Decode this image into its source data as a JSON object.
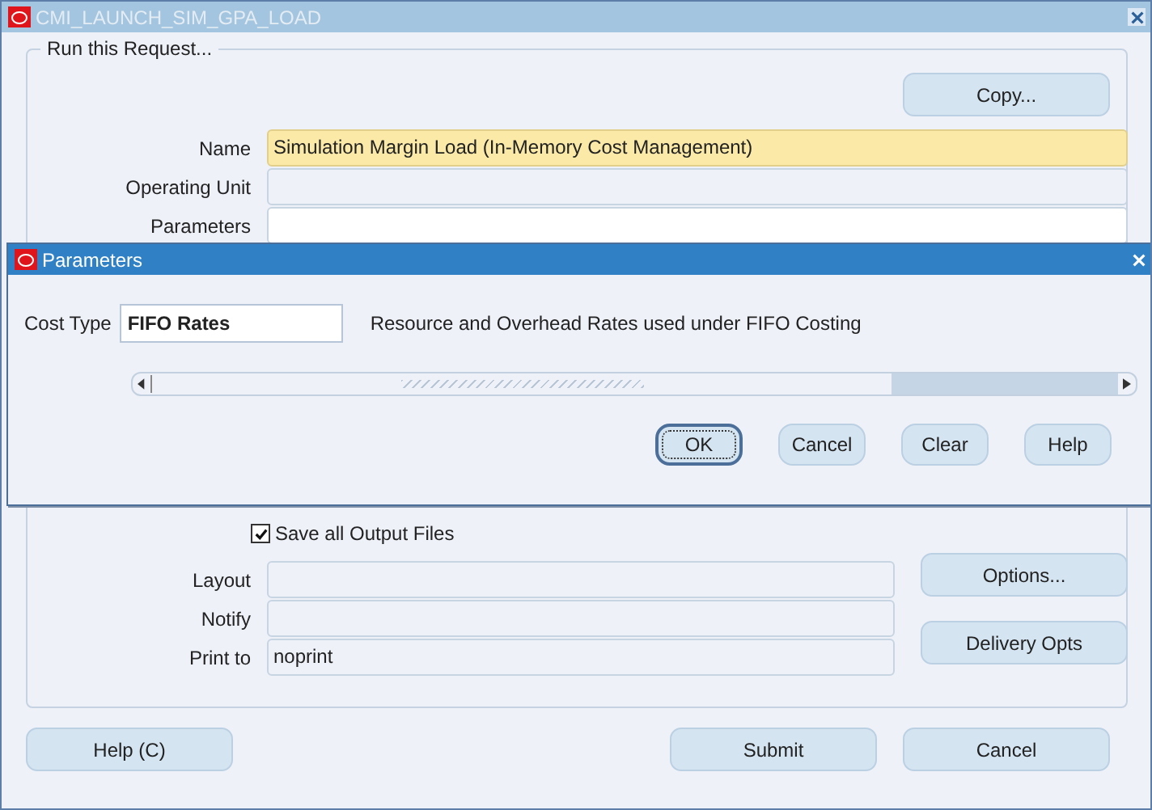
{
  "window": {
    "title": "CMI_LAUNCH_SIM_GPA_LOAD"
  },
  "request_group": {
    "title": "Run this Request...",
    "copy_button": {
      "label": "Copy..."
    },
    "fields": [
      {
        "label": "Name",
        "value": "Simulation Margin Load (In-Memory Cost Management)",
        "kind": "required"
      },
      {
        "label": "Operating Unit",
        "kind": "readonly"
      },
      {
        "label": "Parameters",
        "kind": "editable"
      }
    ]
  },
  "completion_group": {
    "save_output": {
      "label": "Save all Output Files",
      "checked": true
    },
    "fields": [
      {
        "label": "Layout"
      },
      {
        "label": "Notify"
      },
      {
        "label": "Print to",
        "value": "noprint"
      }
    ],
    "buttons": [
      {
        "label": "Options..."
      },
      {
        "label": "Delivery Opts"
      }
    ]
  },
  "footer_buttons": [
    {
      "label": "Help (C)"
    },
    {
      "label": "Submit"
    },
    {
      "label": "Cancel"
    }
  ],
  "dialog": {
    "title": "Parameters",
    "field": {
      "label": "Cost Type",
      "value": "FIFO Rates",
      "description": "Resource and Overhead Rates used under FIFO Costing"
    },
    "buttons": [
      {
        "label": "OK",
        "default": true
      },
      {
        "label": "Cancel",
        "default": false
      },
      {
        "label": "Clear",
        "default": false
      },
      {
        "label": "Help",
        "default": false
      }
    ]
  }
}
